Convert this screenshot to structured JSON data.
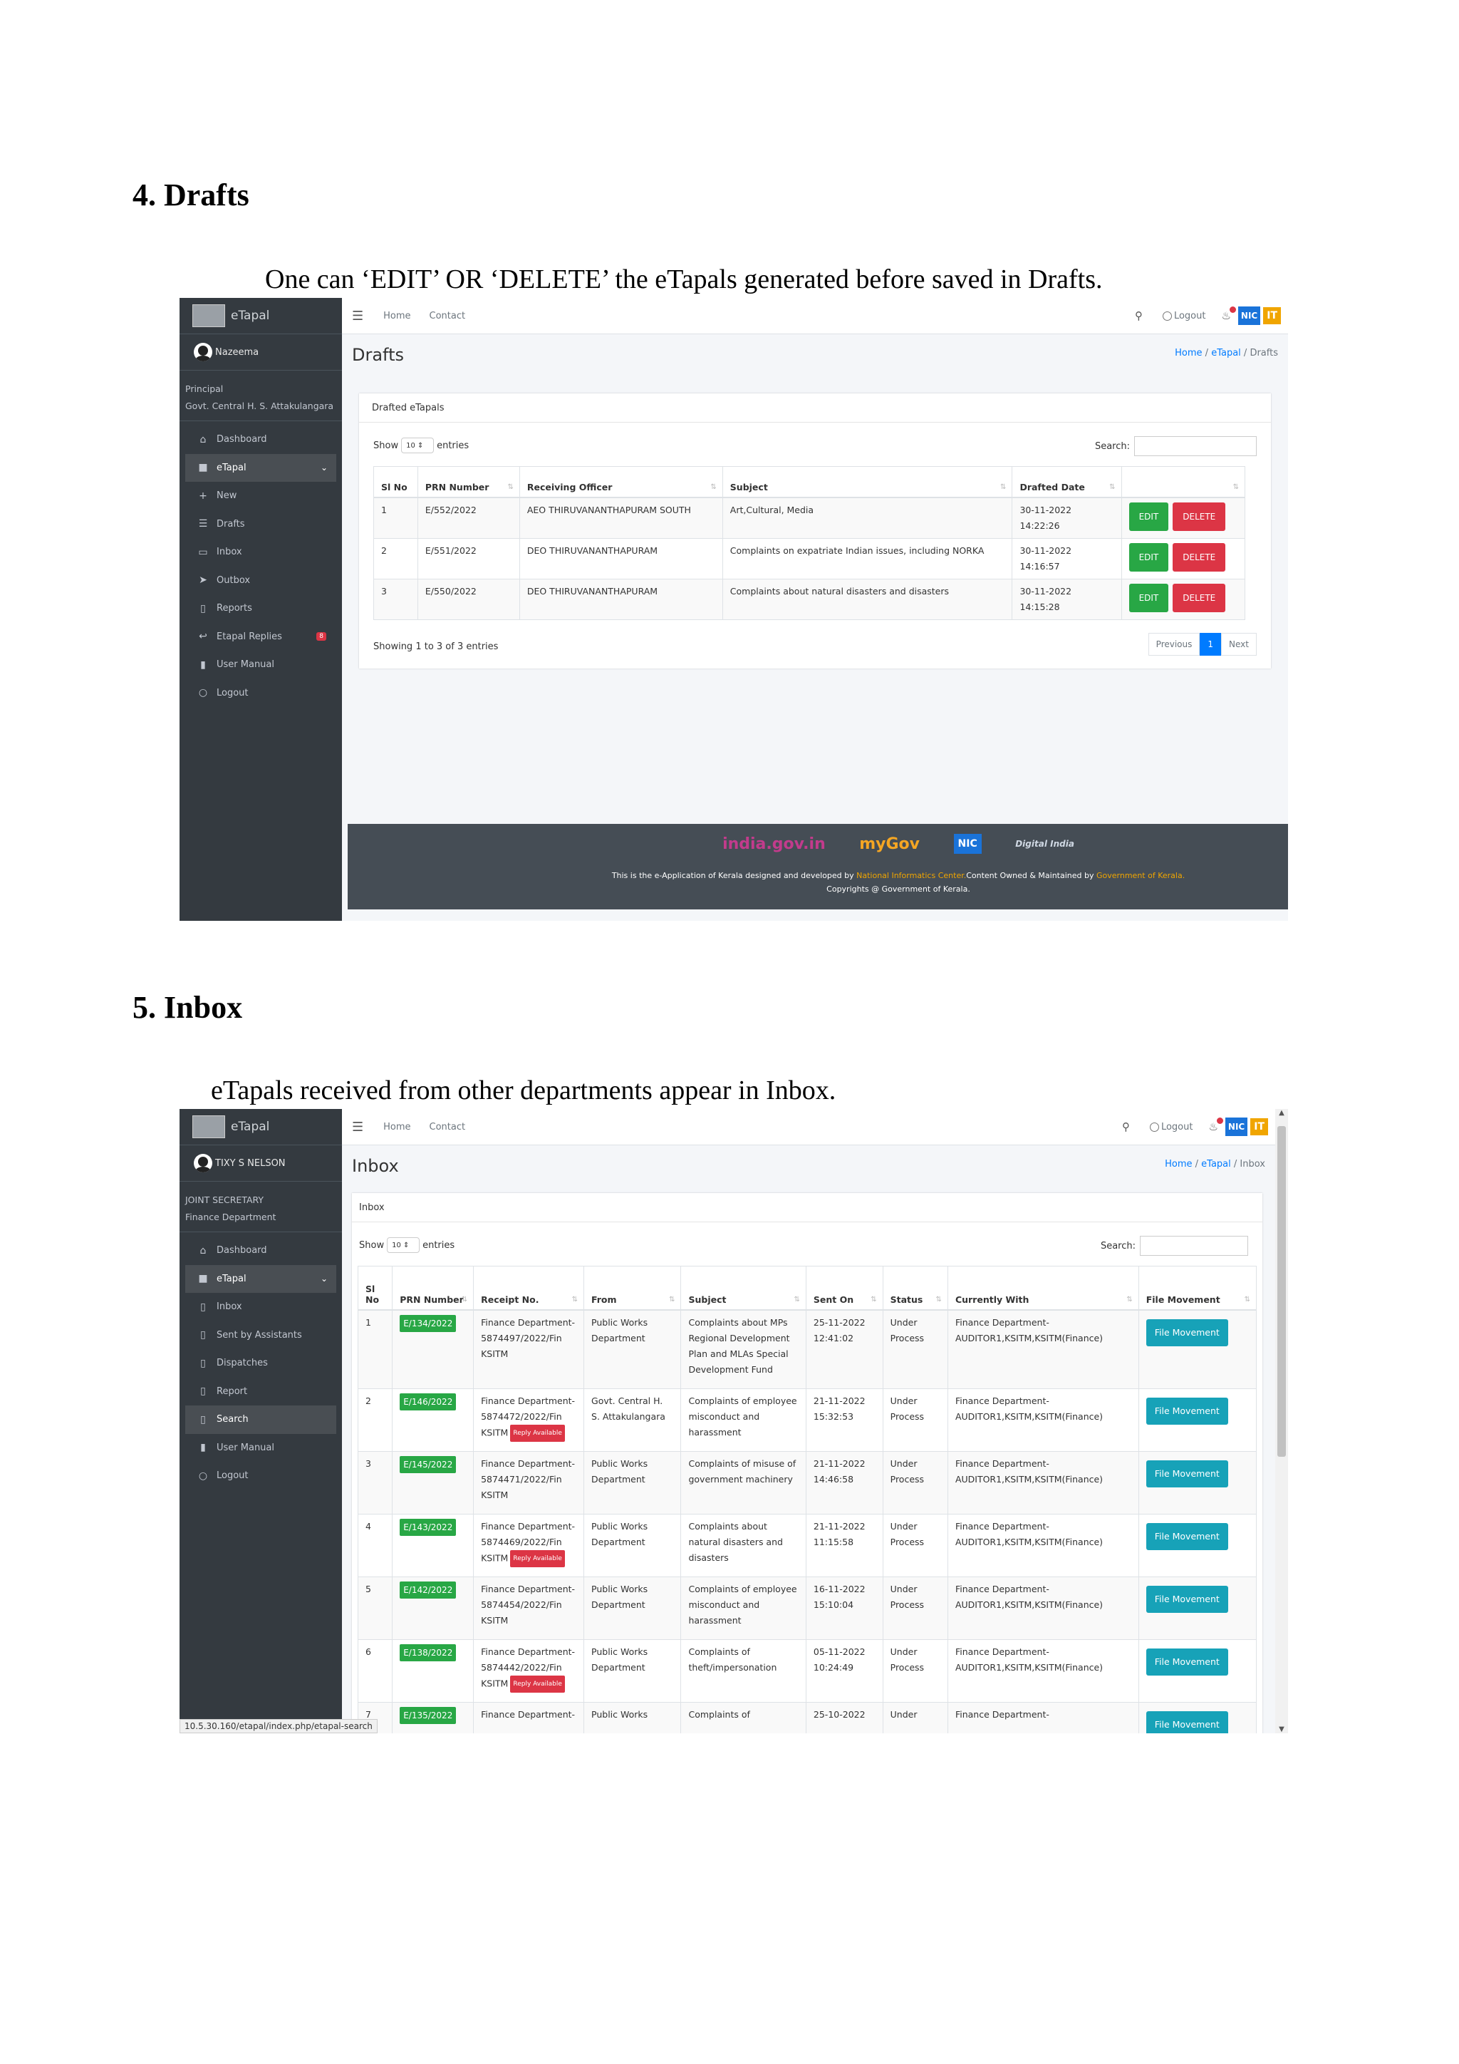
{
  "section4": {
    "heading": "4.  Drafts",
    "description": "One can ‘EDIT’ OR ‘DELETE’ the eTapals generated before saved in Drafts.",
    "screenshot": {
      "brand": "eTapal",
      "user": "Nazeema",
      "role_line1": "Principal",
      "role_line2": "Govt. Central H. S. Attakulangara",
      "nav": [
        {
          "icon": "⌂",
          "label": "Dashboard"
        },
        {
          "icon": "■",
          "label": "eTapal"
        },
        {
          "icon": "+",
          "label": "New"
        },
        {
          "icon": "☰",
          "label": "Drafts"
        },
        {
          "icon": "▭",
          "label": "Inbox"
        },
        {
          "icon": "➤",
          "label": "Outbox"
        },
        {
          "icon": "▯",
          "label": "Reports"
        },
        {
          "icon": "↩",
          "label": "Etapal Replies",
          "badge": "8"
        },
        {
          "icon": "▮",
          "label": "User Manual"
        },
        {
          "icon": "○",
          "label": "Logout"
        }
      ],
      "topbar": {
        "home": "Home",
        "contact": "Contact",
        "logout": "Logout",
        "nic": "NIC",
        "it": "IT"
      },
      "page_title": "Drafts",
      "breadcrumb": [
        "Home",
        "eTapal",
        "Drafts"
      ],
      "card_title": "Drafted eTapals",
      "show_label": "Show",
      "entries_value": "10",
      "entries_label": "entries",
      "search_label": "Search:",
      "columns": [
        "Sl No",
        "PRN Number",
        "Receiving Officer",
        "Subject",
        "Drafted Date",
        ""
      ],
      "rows": [
        {
          "sl": "1",
          "prn": "E/552/2022",
          "officer": "AEO THIRUVANANTHAPURAM SOUTH",
          "subject": "Art,Cultural, Media",
          "date": "30-11-2022 14:22:26"
        },
        {
          "sl": "2",
          "prn": "E/551/2022",
          "officer": "DEO THIRUVANANTHAPURAM",
          "subject": "Complaints on expatriate Indian issues, including NORKA",
          "date": "30-11-2022 14:16:57"
        },
        {
          "sl": "3",
          "prn": "E/550/2022",
          "officer": "DEO THIRUVANANTHAPURAM",
          "subject": "Complaints about natural disasters and disasters",
          "date": "30-11-2022 14:15:28"
        }
      ],
      "edit_label": "EDIT",
      "delete_label": "DELETE",
      "showing": "Showing 1 to 3 of 3 entries",
      "pager": {
        "prev": "Previous",
        "page": "1",
        "next": "Next"
      },
      "footer": {
        "logos": [
          "india.gov.in",
          "myGov",
          "NIC",
          "Digital India"
        ],
        "line1_a": "This is the e-Application of Kerala designed and developed by ",
        "line1_b": "National Informatics Center.",
        "line1_c": "Content Owned & Maintained by ",
        "line1_d": "Government of Kerala.",
        "line2": "Copyrights @ Government of Kerala."
      }
    }
  },
  "section5": {
    "heading": "5.  Inbox",
    "description": "eTapals received from other departments appear  in Inbox.",
    "screenshot": {
      "brand": "eTapal",
      "user": "TIXY S NELSON",
      "role_line1": "JOINT SECRETARY",
      "role_line2": "Finance Department",
      "nav": [
        {
          "icon": "⌂",
          "label": "Dashboard"
        },
        {
          "icon": "■",
          "label": "eTapal"
        },
        {
          "icon": "▯",
          "label": "Inbox"
        },
        {
          "icon": "▯",
          "label": "Sent by Assistants"
        },
        {
          "icon": "▯",
          "label": "Dispatches"
        },
        {
          "icon": "▯",
          "label": "Report"
        },
        {
          "icon": "▯",
          "label": "Search"
        },
        {
          "icon": "▮",
          "label": "User Manual"
        },
        {
          "icon": "○",
          "label": "Logout"
        }
      ],
      "topbar": {
        "home": "Home",
        "contact": "Contact",
        "logout": "Logout",
        "nic": "NIC",
        "it": "IT"
      },
      "page_title": "Inbox",
      "breadcrumb": [
        "Home",
        "eTapal",
        "Inbox"
      ],
      "card_title": "Inbox",
      "show_label": "Show",
      "entries_value": "10",
      "entries_label": "entries",
      "search_label": "Search:",
      "columns": [
        "Sl No",
        "PRN Number",
        "Receipt No.",
        "From",
        "Subject",
        "Sent On",
        "Status",
        "Currently With",
        "File Movement"
      ],
      "rows": [
        {
          "sl": "1",
          "prn": "E/134/2022",
          "receipt": "Finance Department-5874497/2022/Fin KSITM",
          "reply": "",
          "from": "Public Works Department",
          "subject": "Complaints about MPs Regional Development Plan and MLAs Special Development Fund",
          "sent": "25-11-2022 12:41:02",
          "status": "Under Process",
          "with": "Finance Department-AUDITOR1,KSITM,KSITM(Finance)"
        },
        {
          "sl": "2",
          "prn": "E/146/2022",
          "receipt": "Finance Department-5874472/2022/Fin KSITM",
          "reply": "Reply Available",
          "from": "Govt. Central H. S. Attakulangara",
          "subject": "Complaints of employee misconduct and harassment",
          "sent": "21-11-2022 15:32:53",
          "status": "Under Process",
          "with": "Finance Department-AUDITOR1,KSITM,KSITM(Finance)"
        },
        {
          "sl": "3",
          "prn": "E/145/2022",
          "receipt": "Finance Department-5874471/2022/Fin KSITM",
          "reply": "",
          "from": "Public Works Department",
          "subject": "Complaints of misuse of government machinery",
          "sent": "21-11-2022 14:46:58",
          "status": "Under Process",
          "with": "Finance Department-AUDITOR1,KSITM,KSITM(Finance)"
        },
        {
          "sl": "4",
          "prn": "E/143/2022",
          "receipt": "Finance Department-5874469/2022/Fin KSITM",
          "reply": "Reply Available",
          "from": "Public Works Department",
          "subject": "Complaints about natural disasters and disasters",
          "sent": "21-11-2022 11:15:58",
          "status": "Under Process",
          "with": "Finance Department-AUDITOR1,KSITM,KSITM(Finance)"
        },
        {
          "sl": "5",
          "prn": "E/142/2022",
          "receipt": "Finance Department-5874454/2022/Fin KSITM",
          "reply": "",
          "from": "Public Works Department",
          "subject": "Complaints of employee misconduct and harassment",
          "sent": "16-11-2022 15:10:04",
          "status": "Under Process",
          "with": "Finance Department-AUDITOR1,KSITM,KSITM(Finance)"
        },
        {
          "sl": "6",
          "prn": "E/138/2022",
          "receipt": "Finance Department-5874442/2022/Fin KSITM",
          "reply": "Reply Available",
          "from": "Public Works Department",
          "subject": "Complaints of theft/impersonation",
          "sent": "05-11-2022 10:24:49",
          "status": "Under Process",
          "with": "Finance Department-AUDITOR1,KSITM,KSITM(Finance)"
        },
        {
          "sl": "7",
          "prn": "E/135/2022",
          "receipt": "Finance Department-",
          "reply": "",
          "from": "Public Works",
          "subject": "Complaints of",
          "sent": "25-10-2022",
          "status": "Under",
          "with": "Finance Department-"
        }
      ],
      "file_movement_label": "File Movement",
      "status_url": "10.5.30.160/etapal/index.php/etapal-search"
    }
  }
}
